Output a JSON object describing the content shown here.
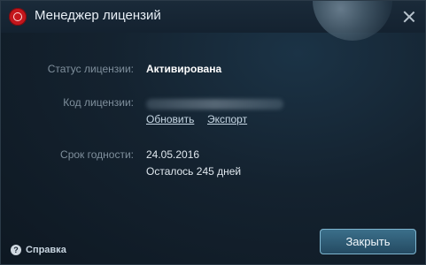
{
  "window": {
    "title": "Менеджер лицензий",
    "accent_color": "#c4161c"
  },
  "license": {
    "status_label": "Статус лицензии:",
    "status_value": "Активирована",
    "code_label": "Код лицензии:",
    "update_link": "Обновить",
    "export_link": "Экспорт",
    "expiry_label": "Срок годности:",
    "expiry_date": "24.05.2016",
    "days_left": "Осталось 245 дней"
  },
  "footer": {
    "help_label": "Справка",
    "close_label": "Закрыть"
  }
}
